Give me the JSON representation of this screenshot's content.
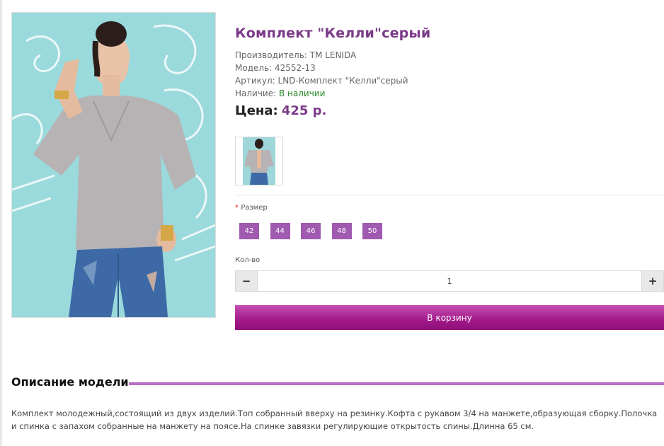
{
  "product": {
    "title": "Комплект \"Келли\"серый",
    "manufacturer_label": "Производитель:",
    "manufacturer": "ТМ LENIDA",
    "model_label": "Модель:",
    "model": "42552-13",
    "sku_label": "Артикул:",
    "sku": "LND-Комплект \"Келли\"серый",
    "availability_label": "Наличие:",
    "availability": "В наличии",
    "price_label": "Цена:",
    "price": "425 р."
  },
  "options": {
    "size_required_mark": "*",
    "size_label": "Размер",
    "sizes": [
      "42",
      "44",
      "46",
      "48",
      "50"
    ]
  },
  "quantity": {
    "label": "Кол-во",
    "minus": "−",
    "value": "1",
    "plus": "+"
  },
  "cart": {
    "button_label": "В корзину"
  },
  "description": {
    "heading": "Описание модели",
    "text": "Комплект молодежный,состоящий из двух изделий.Топ собранный вверху на резинку.Кофта с рукавом 3/4 на манжете,образующая сборку.Полочка и спинка с запахом собранные на манжету на поясе.На спинке завязки регулирующие открытость спины.Длинна 65 см."
  },
  "colors": {
    "accent": "#7b3a88",
    "size_button": "#a05ab0",
    "cart_button": "#a3198a",
    "in_stock": "#2a8a2a"
  }
}
